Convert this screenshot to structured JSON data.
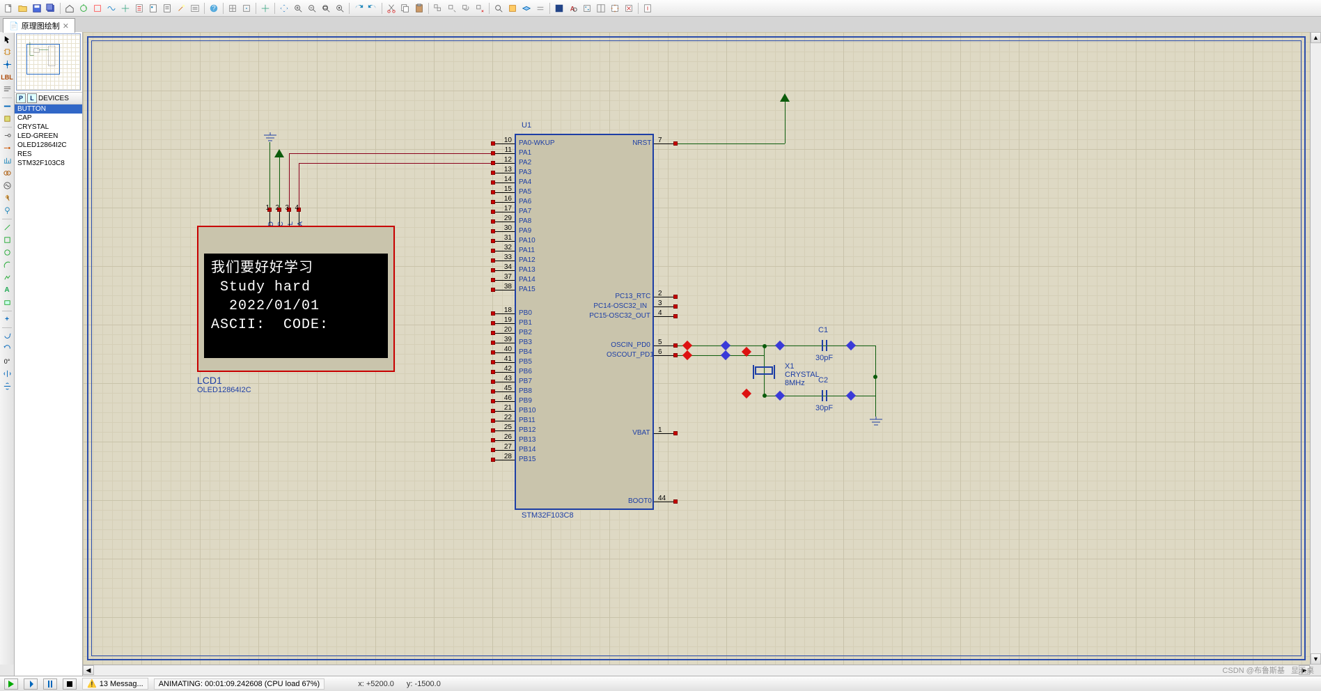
{
  "tab": {
    "title": "原理图绘制"
  },
  "device_header": "DEVICES",
  "devices": [
    "BUTTON",
    "CAP",
    "CRYSTAL",
    "LED-GREEN",
    "OLED12864I2C",
    "RES",
    "STM32F103C8"
  ],
  "selected_device": 0,
  "lcd": {
    "ref": "LCD1",
    "part": "OLED12864I2C",
    "pins": [
      "GND",
      "VCC",
      "SCL",
      "SDA"
    ],
    "pin_nums": [
      "1",
      "2",
      "3",
      "4"
    ],
    "line1": "我们要好好学习",
    "line2": " Study hard",
    "line3": "  2022/01/01",
    "line4": "ASCII:  CODE:"
  },
  "mcu": {
    "ref": "U1",
    "part": "STM32F103C8",
    "left": [
      {
        "n": "10",
        "name": "PA0-WKUP"
      },
      {
        "n": "11",
        "name": "PA1"
      },
      {
        "n": "12",
        "name": "PA2"
      },
      {
        "n": "13",
        "name": "PA3"
      },
      {
        "n": "14",
        "name": "PA4"
      },
      {
        "n": "15",
        "name": "PA5"
      },
      {
        "n": "16",
        "name": "PA6"
      },
      {
        "n": "17",
        "name": "PA7"
      },
      {
        "n": "29",
        "name": "PA8"
      },
      {
        "n": "30",
        "name": "PA9"
      },
      {
        "n": "31",
        "name": "PA10"
      },
      {
        "n": "32",
        "name": "PA11"
      },
      {
        "n": "33",
        "name": "PA12"
      },
      {
        "n": "34",
        "name": "PA13"
      },
      {
        "n": "37",
        "name": "PA14"
      },
      {
        "n": "38",
        "name": "PA15"
      }
    ],
    "left2": [
      {
        "n": "18",
        "name": "PB0"
      },
      {
        "n": "19",
        "name": "PB1"
      },
      {
        "n": "20",
        "name": "PB2"
      },
      {
        "n": "39",
        "name": "PB3"
      },
      {
        "n": "40",
        "name": "PB4"
      },
      {
        "n": "41",
        "name": "PB5"
      },
      {
        "n": "42",
        "name": "PB6"
      },
      {
        "n": "43",
        "name": "PB7"
      },
      {
        "n": "45",
        "name": "PB8"
      },
      {
        "n": "46",
        "name": "PB9"
      },
      {
        "n": "21",
        "name": "PB10"
      },
      {
        "n": "22",
        "name": "PB11"
      },
      {
        "n": "25",
        "name": "PB12"
      },
      {
        "n": "26",
        "name": "PB13"
      },
      {
        "n": "27",
        "name": "PB14"
      },
      {
        "n": "28",
        "name": "PB15"
      }
    ],
    "right": [
      {
        "n": "7",
        "name": "NRST"
      },
      {
        "n": "2",
        "name": "PC13_RTC"
      },
      {
        "n": "3",
        "name": "PC14-OSC32_IN"
      },
      {
        "n": "4",
        "name": "PC15-OSC32_OUT"
      },
      {
        "n": "5",
        "name": "OSCIN_PD0"
      },
      {
        "n": "6",
        "name": "OSCOUT_PD1"
      },
      {
        "n": "1",
        "name": "VBAT"
      },
      {
        "n": "44",
        "name": "BOOT0"
      }
    ]
  },
  "crystal": {
    "ref": "X1",
    "part": "CRYSTAL",
    "value": "8MHz"
  },
  "c1": {
    "ref": "C1",
    "value": "30pF"
  },
  "c2": {
    "ref": "C2",
    "value": "30pF"
  },
  "status": {
    "messages": "13 Messag...",
    "anim": "ANIMATING: 00:01:09.242608 (CPU load 67%)",
    "coord_x_lbl": "x:",
    "coord_x": "+5200.0",
    "coord_y_lbl": "y:",
    "coord_y": "-1500.0"
  },
  "watermark": "CSDN @布鲁斯基",
  "screen_text": "显示桌"
}
